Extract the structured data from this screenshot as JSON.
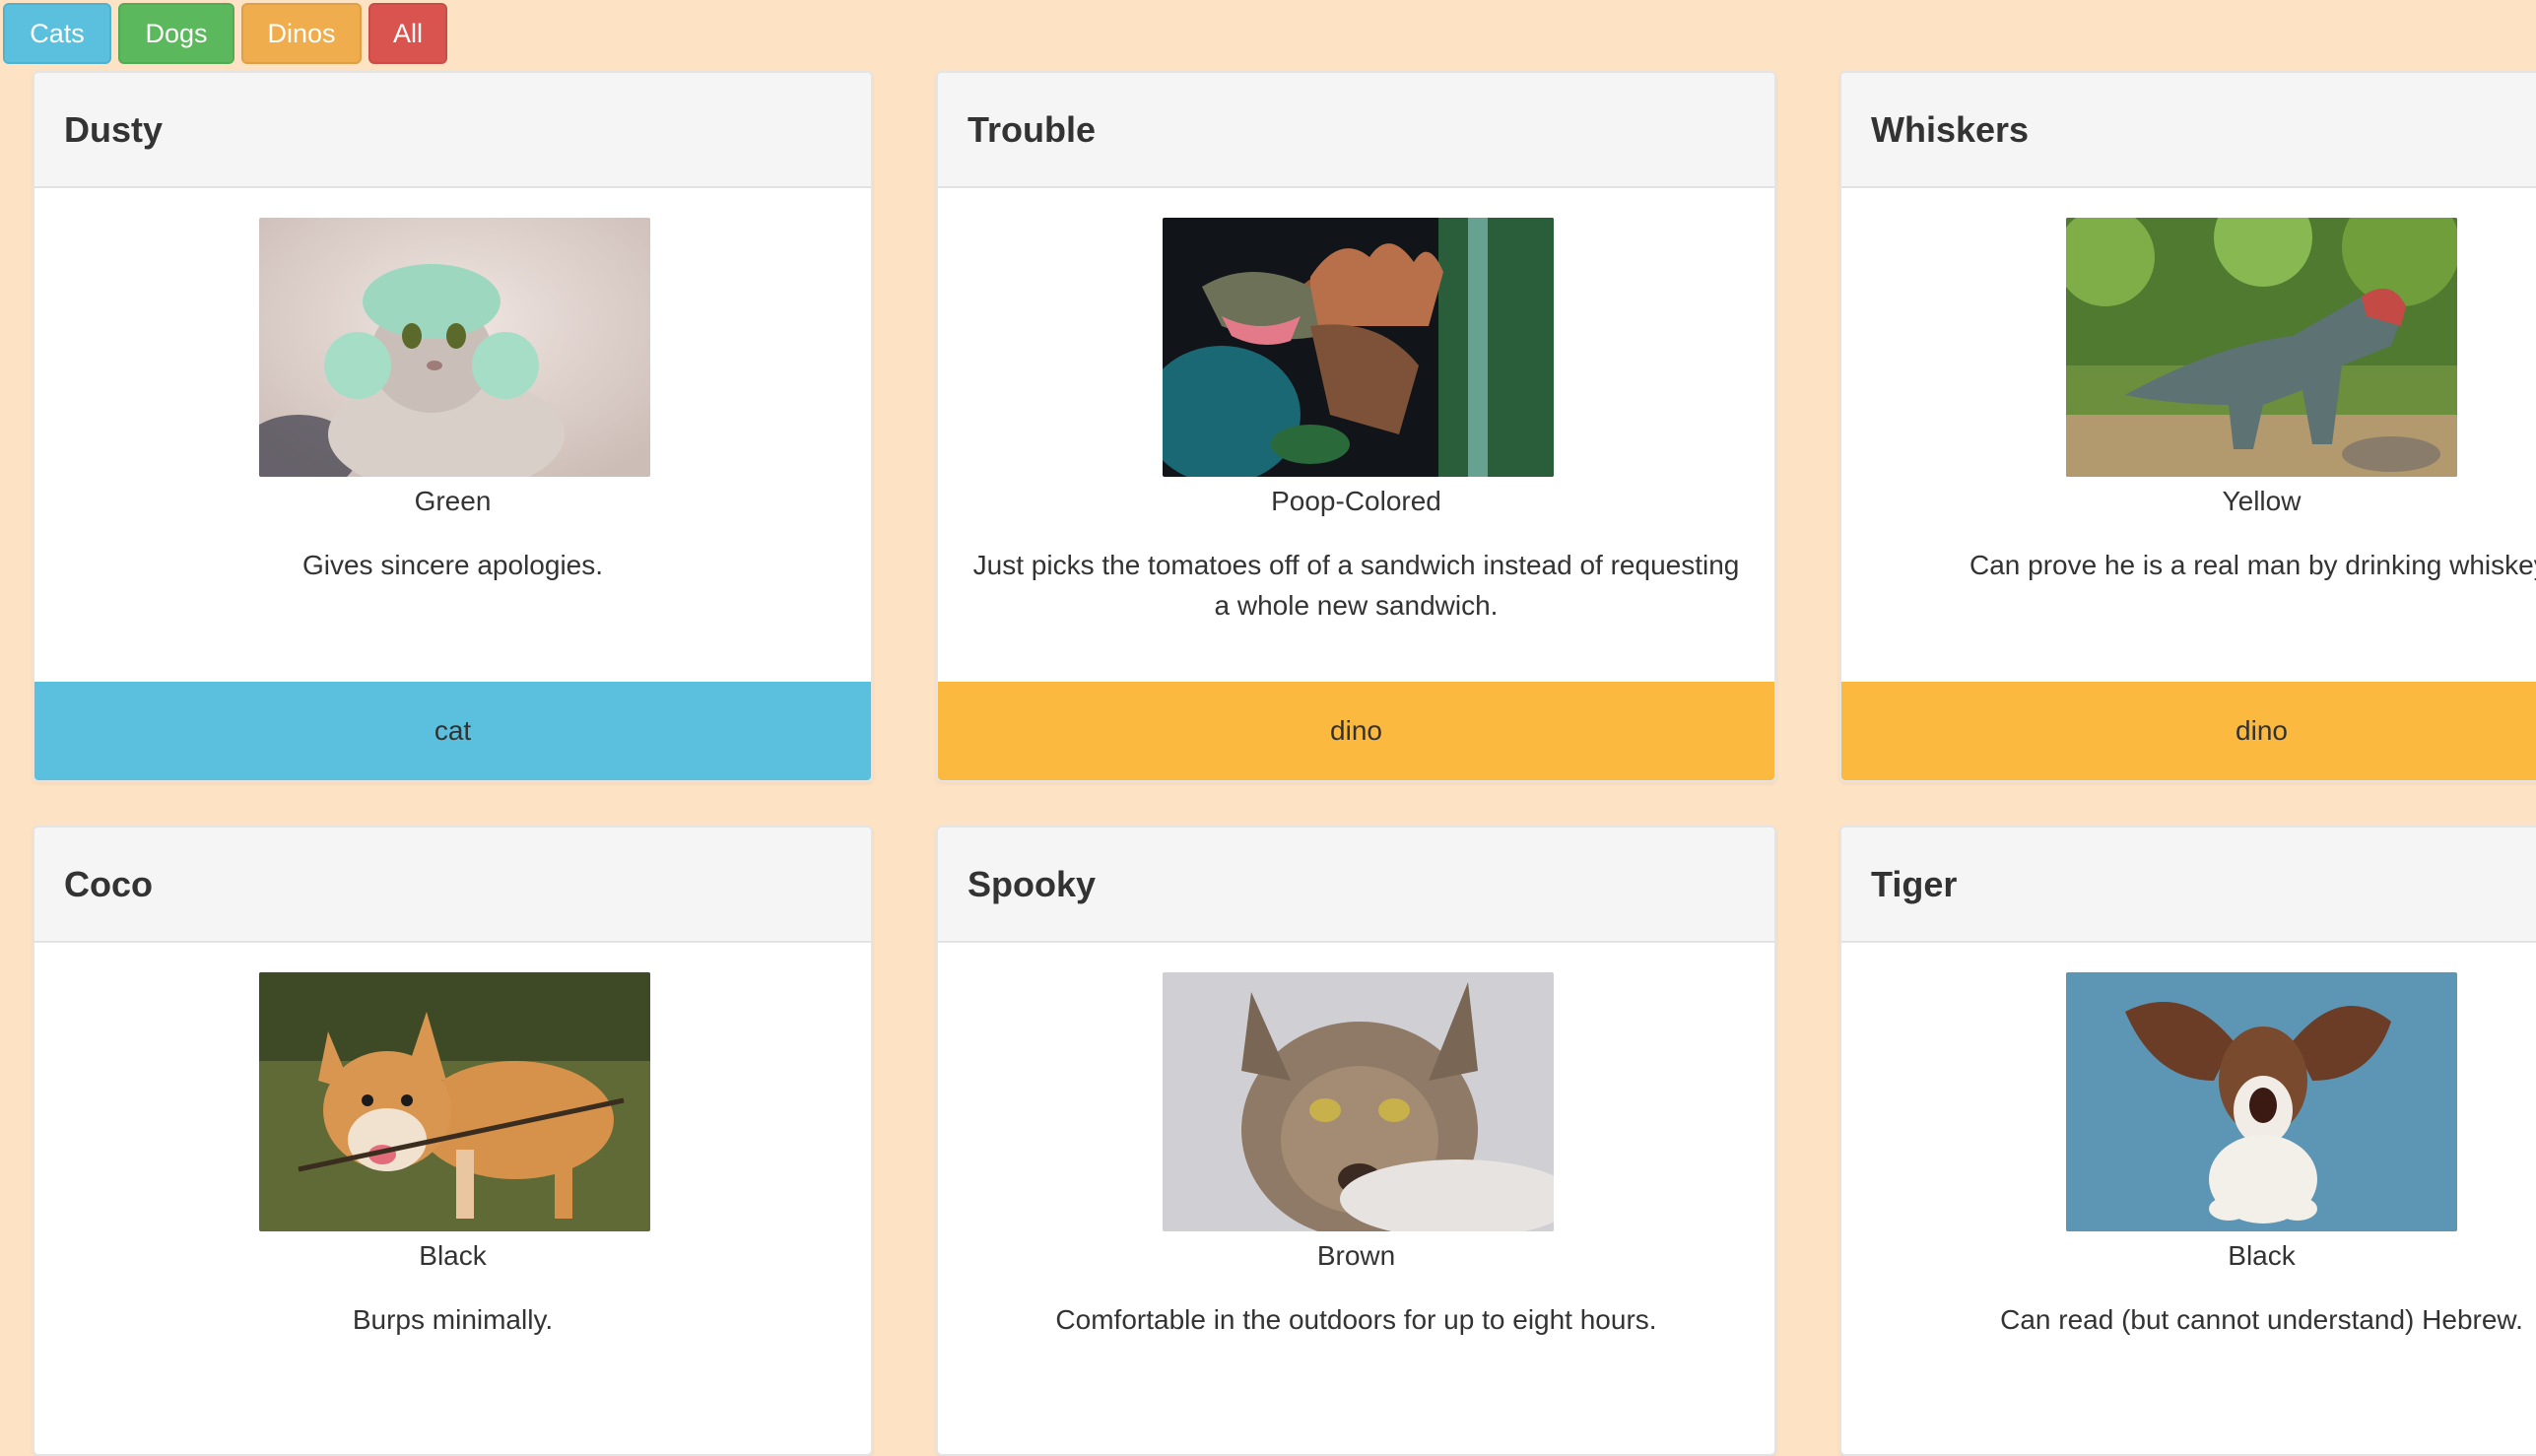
{
  "filters": {
    "cats": "Cats",
    "dogs": "Dogs",
    "dinos": "Dinos",
    "all": "All"
  },
  "colors": {
    "background": "#fde3c3",
    "cat_footer": "#5bc0de",
    "dino_footer": "#fbb940",
    "cats_button": "#5bc0de",
    "dogs_button": "#5cb85c",
    "dinos_button": "#f0ad4e",
    "all_button": "#d9534f"
  },
  "cards": [
    {
      "name": "Dusty",
      "image": "cat-with-green-towel-photo",
      "color": "Green",
      "description": "Gives sincere apologies.",
      "type": "cat"
    },
    {
      "name": "Trouble",
      "image": "spinosaurus-model-photo",
      "color": "Poop-Colored",
      "description": "Just picks the tomatoes off of a sandwich instead of requesting a whole new sandwich.",
      "type": "dino"
    },
    {
      "name": "Whiskers",
      "image": "t-rex-statue-in-forest-photo",
      "color": "Yellow",
      "description": "Can prove he is a real man by drinking whiskey.",
      "type": "dino"
    },
    {
      "name": "Coco",
      "image": "corgi-with-stick-photo",
      "color": "Black",
      "description": "Burps minimally.",
      "type": ""
    },
    {
      "name": "Spooky",
      "image": "maine-coon-cat-photo",
      "color": "Brown",
      "description": "Comfortable in the outdoors for up to eight hours.",
      "type": ""
    },
    {
      "name": "Tiger",
      "image": "basset-hound-flying-ears-photo",
      "color": "Black",
      "description": "Can read (but cannot understand) Hebrew.",
      "type": ""
    }
  ]
}
